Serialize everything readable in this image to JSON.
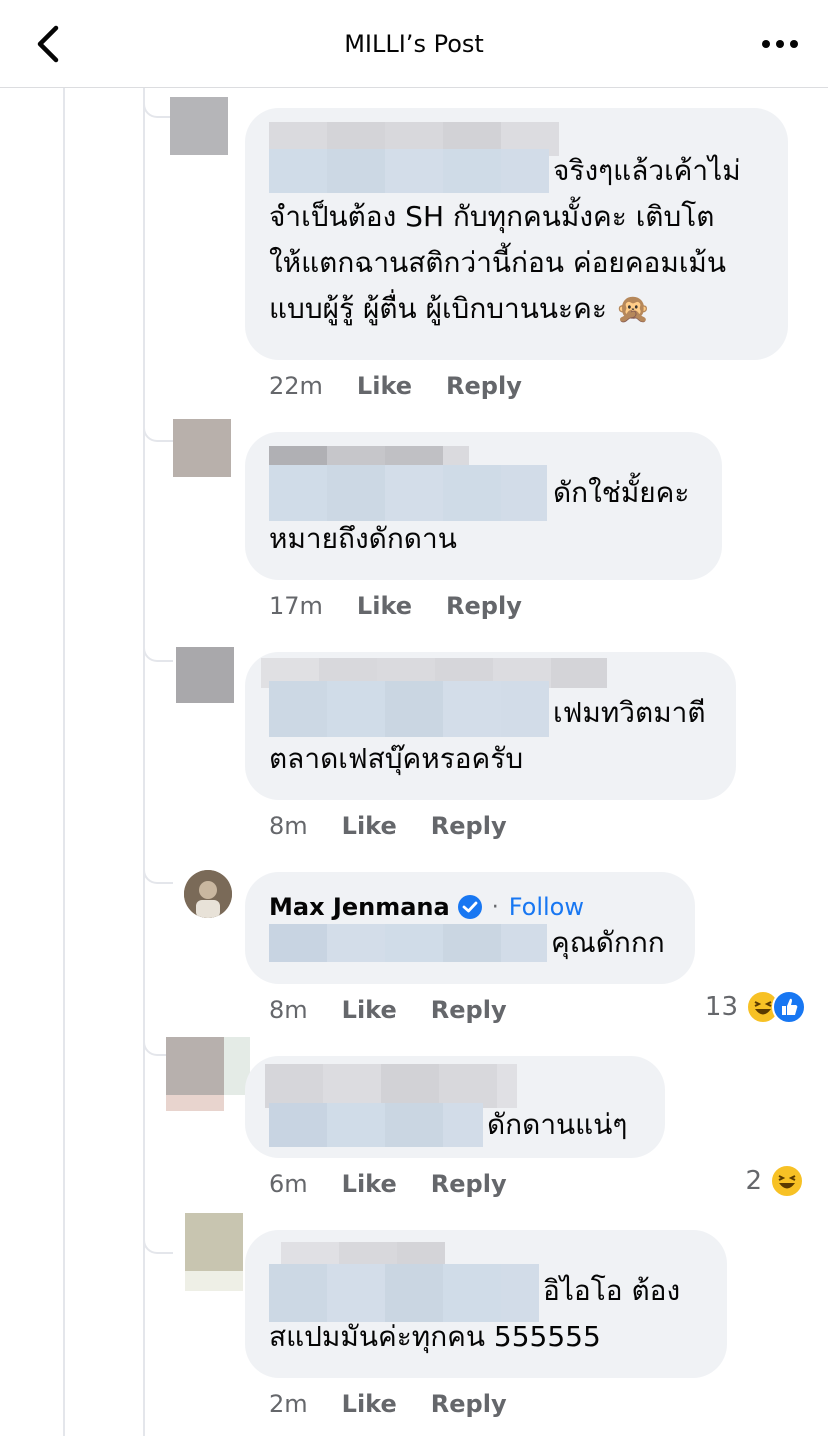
{
  "header": {
    "title": "MILLI’s Post"
  },
  "icons": {
    "back": "chevron-left-icon",
    "more": "more-horizontal-icon"
  },
  "colors": {
    "link": "#1877f2",
    "bubble": "#f0f2f5",
    "meta": "#65676b",
    "haha": "#f7c125"
  },
  "comments": [
    {
      "lines": [
        "จริงๆแล้วเค้าไม่",
        "จำเป็นต้อง SH กับทุกคนมั้งคะ เติบโต",
        "ให้แตกฉานสติกว่านี้ก่อน ค่อยคอมเม้น",
        "แบบผู้รู้ ผู้ตื่น ผู้เบิกบานนะคะ 🙊"
      ],
      "time": "22m",
      "like": "Like",
      "reply": "Reply"
    },
    {
      "lines": [
        "ดักใช่มั้ยคะ",
        "หมายถึงดักดาน"
      ],
      "time": "17m",
      "like": "Like",
      "reply": "Reply"
    },
    {
      "lines": [
        "เฟมทวิตมาตี",
        "ตลาดเฟสบุ๊คหรอครับ"
      ],
      "time": "8m",
      "like": "Like",
      "reply": "Reply"
    },
    {
      "author": "Max Jenmana",
      "separator": "·",
      "follow": "Follow",
      "lines": [
        "คุณดักกก"
      ],
      "time": "8m",
      "like": "Like",
      "reply": "Reply",
      "reaction_count": "13"
    },
    {
      "lines": [
        "ดักดานแน่ๆ"
      ],
      "time": "6m",
      "like": "Like",
      "reply": "Reply",
      "reaction_count": "2"
    },
    {
      "lines": [
        "อิไอโอ ต้อง",
        "สแปมมันค่ะทุกคน 555555"
      ],
      "time": "2m",
      "like": "Like",
      "reply": "Reply"
    }
  ]
}
